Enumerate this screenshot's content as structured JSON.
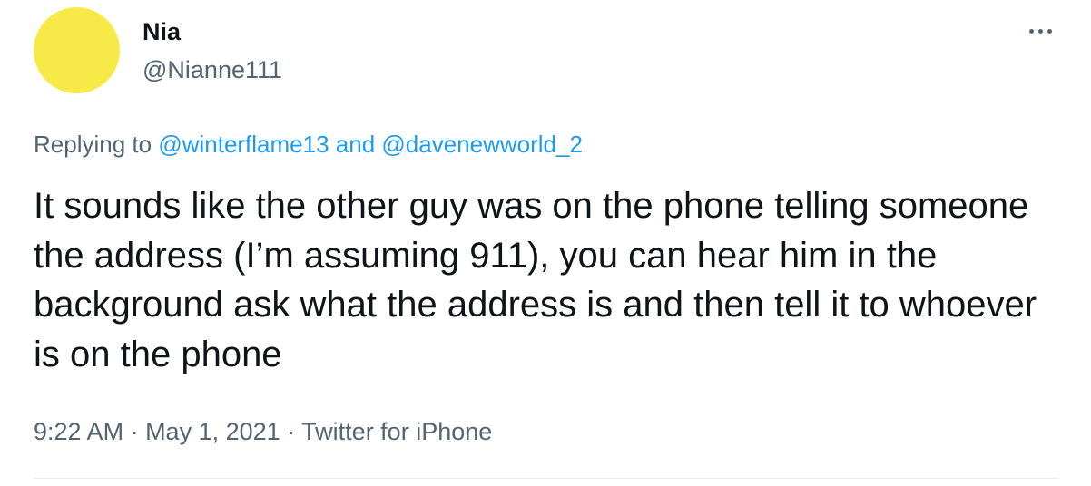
{
  "user": {
    "display_name": "Nia",
    "handle": "@Nianne111",
    "avatar_color": "#f7ea48"
  },
  "more_menu_icon": "ellipsis-icon",
  "reply": {
    "prefix": "Replying to ",
    "mention_1": "@winterflame13",
    "separator": " and ",
    "mention_2": "@davenewworld_2"
  },
  "tweet_text": "It sounds like the other guy was on the phone telling someone the address (I’m assuming 911), you can hear him in the background ask what the address is and then tell it to whoever is on the phone",
  "meta": {
    "time": "9:22 AM",
    "sep1": " · ",
    "date": "May 1, 2021",
    "sep2": " · ",
    "source": "Twitter for iPhone"
  },
  "colors": {
    "link": "#1d9bf0",
    "secondary_text": "#536471",
    "primary_text": "#0f1419"
  }
}
